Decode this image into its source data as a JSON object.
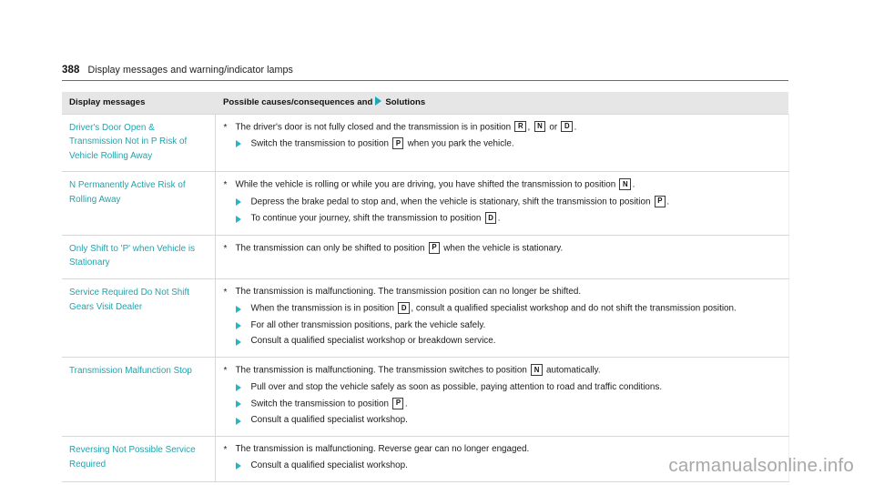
{
  "page": {
    "number": "388",
    "running_title": "Display messages and warning/indicator lamps",
    "watermark": "carmanualsonline.info",
    "accent_color": "#21a3ad",
    "arrow_color": "#25b6c4",
    "header_bg": "#e6e6e6"
  },
  "table": {
    "columns": {
      "col1_header": "Display messages",
      "col2_header_prefix": "Possible causes/consequences and",
      "col2_header_suffix": "Solutions",
      "col2_arrow_icon": "solution-arrow-icon"
    },
    "rows": [
      {
        "message": "Driver's Door Open & Transmission Not in P Risk of Vehicle Rolling Away",
        "cause_bullet": "*",
        "cause_parts": [
          {
            "t": "text",
            "v": "The driver's door is not fully closed and the transmission is in position "
          },
          {
            "t": "pos",
            "v": "R"
          },
          {
            "t": "text",
            "v": ", "
          },
          {
            "t": "pos",
            "v": "N"
          },
          {
            "t": "text",
            "v": " or "
          },
          {
            "t": "pos",
            "v": "D"
          },
          {
            "t": "text",
            "v": "."
          }
        ],
        "solutions": [
          [
            {
              "t": "text",
              "v": "Switch the transmission to position "
            },
            {
              "t": "pos",
              "v": "P"
            },
            {
              "t": "text",
              "v": " when you park the vehicle."
            }
          ]
        ]
      },
      {
        "message": "N Permanently Active Risk of Rolling Away",
        "cause_bullet": "*",
        "cause_parts": [
          {
            "t": "text",
            "v": "While the vehicle is rolling or while you are driving, you have shifted the transmission to position "
          },
          {
            "t": "pos",
            "v": "N"
          },
          {
            "t": "text",
            "v": "."
          }
        ],
        "solutions": [
          [
            {
              "t": "text",
              "v": "Depress the brake pedal to stop and, when the vehicle is stationary, shift the transmission to position "
            },
            {
              "t": "pos",
              "v": "P"
            },
            {
              "t": "text",
              "v": "."
            }
          ],
          [
            {
              "t": "text",
              "v": "To continue your journey, shift the transmission to position "
            },
            {
              "t": "pos",
              "v": "D"
            },
            {
              "t": "text",
              "v": "."
            }
          ]
        ]
      },
      {
        "message": "Only Shift to 'P' when Vehicle is Stationary",
        "cause_bullet": "*",
        "cause_parts": [
          {
            "t": "text",
            "v": "The transmission can only be shifted to position "
          },
          {
            "t": "pos",
            "v": "P"
          },
          {
            "t": "text",
            "v": " when the vehicle is stationary."
          }
        ],
        "solutions": []
      },
      {
        "message": "Service Required Do Not Shift Gears Visit Dealer",
        "cause_bullet": "*",
        "cause_parts": [
          {
            "t": "text",
            "v": "The transmission is malfunctioning. The transmission position can no longer be shifted."
          }
        ],
        "solutions": [
          [
            {
              "t": "text",
              "v": "When the transmission is in position "
            },
            {
              "t": "pos",
              "v": "D"
            },
            {
              "t": "text",
              "v": ", consult a qualified specialist workshop and do not shift the transmission position."
            }
          ],
          [
            {
              "t": "text",
              "v": "For all other transmission positions, park the vehicle safely."
            }
          ],
          [
            {
              "t": "text",
              "v": "Consult a qualified specialist workshop or breakdown service."
            }
          ]
        ]
      },
      {
        "message": "Transmission Malfunction Stop",
        "cause_bullet": "*",
        "cause_parts": [
          {
            "t": "text",
            "v": "The transmission is malfunctioning. The transmission switches to position "
          },
          {
            "t": "pos",
            "v": "N"
          },
          {
            "t": "text",
            "v": " automatically."
          }
        ],
        "solutions": [
          [
            {
              "t": "text",
              "v": "Pull over and stop the vehicle safely as soon as possible, paying attention to road and traffic conditions."
            }
          ],
          [
            {
              "t": "text",
              "v": "Switch the transmission to position "
            },
            {
              "t": "pos",
              "v": "P"
            },
            {
              "t": "text",
              "v": "."
            }
          ],
          [
            {
              "t": "text",
              "v": "Consult a qualified specialist workshop."
            }
          ]
        ]
      },
      {
        "message": "Reversing Not Possible Service Required",
        "cause_bullet": "*",
        "cause_parts": [
          {
            "t": "text",
            "v": "The transmission is malfunctioning. Reverse gear can no longer engaged."
          }
        ],
        "solutions": [
          [
            {
              "t": "text",
              "v": "Consult a qualified specialist workshop."
            }
          ]
        ]
      }
    ]
  }
}
